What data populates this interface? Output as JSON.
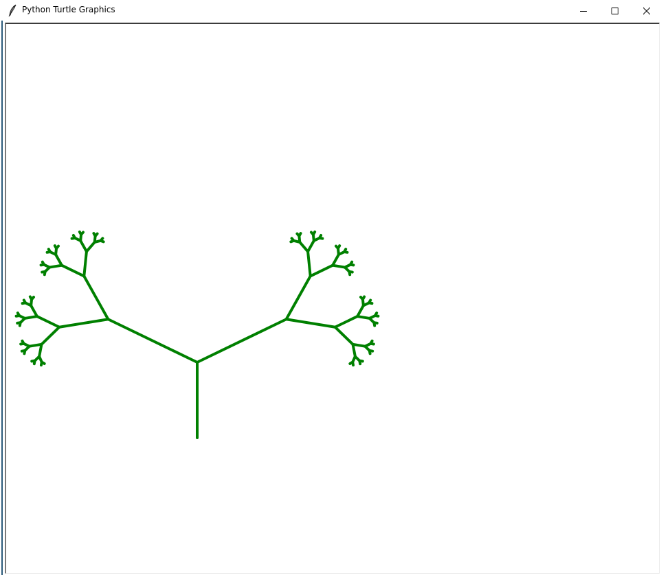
{
  "window": {
    "title": "Python Turtle Graphics",
    "app_icon": "feather-icon",
    "controls": {
      "minimize": "minimize-icon",
      "maximize": "maximize-icon",
      "close": "close-icon"
    }
  },
  "drawing": {
    "type": "fractal-tree",
    "pen_color": "#008000",
    "background": "#ffffff",
    "trunk_length": 110,
    "length_ratio": 0.5,
    "branch_angle_deg": 70,
    "branches_per_node": 2,
    "depth": 6
  },
  "colors": {
    "accent": "#008000",
    "titlebar": "#ffffff",
    "canvas": "#ffffff"
  }
}
